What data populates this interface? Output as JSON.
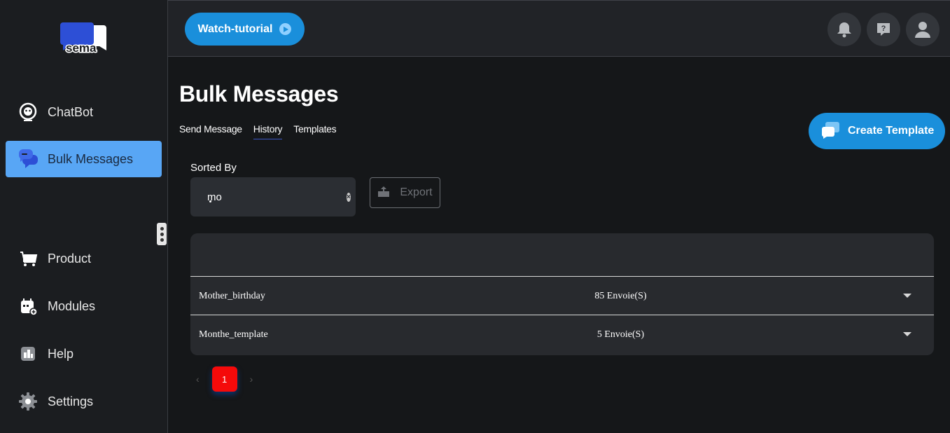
{
  "brand": {
    "name": "sema"
  },
  "sidebar": {
    "items": [
      {
        "label": "ChatBot",
        "icon": "robot-icon",
        "active": false
      },
      {
        "label": "Bulk Messages",
        "icon": "chat-bubbles-icon",
        "active": true
      },
      {
        "label": "Product",
        "icon": "cart-icon",
        "active": false
      },
      {
        "label": "Modules",
        "icon": "calendar-plus-icon",
        "active": false
      },
      {
        "label": "Help",
        "icon": "help-box-icon",
        "active": false
      },
      {
        "label": "Settings",
        "icon": "gear-icon",
        "active": false
      }
    ]
  },
  "topbar": {
    "watch_label": "Watch-tutorial",
    "icons": [
      "bell-icon",
      "question-icon",
      "user-icon"
    ]
  },
  "main": {
    "title": "Bulk Messages",
    "tabs": [
      {
        "label": "Send Message",
        "active": false
      },
      {
        "label": "History",
        "active": true
      },
      {
        "label": "Templates",
        "active": false
      }
    ],
    "create_label": "Create Template",
    "sorted_by_label": "Sorted By",
    "search_value": "mo",
    "export_label": "Export",
    "rows": [
      {
        "name": "Mother_birthday",
        "sends": "85 Envoie(S)"
      },
      {
        "name": "Monthe_template",
        "sends": "5 Envoie(S)"
      }
    ],
    "pagination": {
      "prev": "‹",
      "current": "1",
      "next": "›"
    }
  },
  "colors": {
    "accent": "#1a8fdb",
    "active_nav": "#58a6f5",
    "page_btn": "#f50a0a"
  }
}
